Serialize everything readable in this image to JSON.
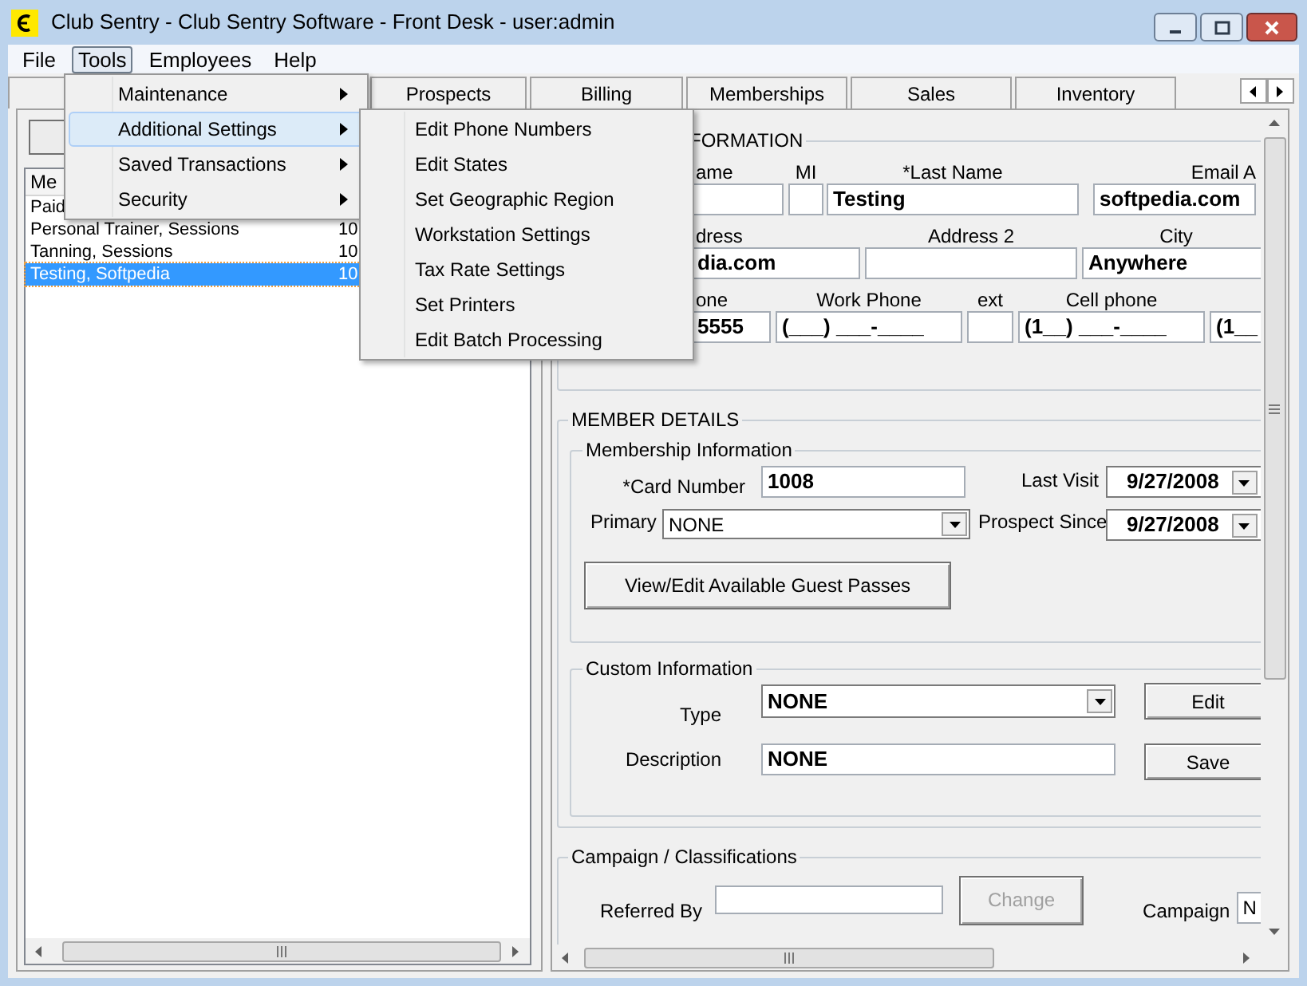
{
  "window": {
    "title": "Club Sentry - Club Sentry Software - Front Desk - user:admin"
  },
  "menu_bar": [
    {
      "label": "File",
      "selected": false
    },
    {
      "label": "Tools",
      "selected": true
    },
    {
      "label": "Employees",
      "selected": false
    },
    {
      "label": "Help",
      "selected": false
    }
  ],
  "tabs": [
    {
      "label": "Prospects"
    },
    {
      "label": "Billing"
    },
    {
      "label": "Memberships"
    },
    {
      "label": "Sales"
    },
    {
      "label": "Inventory"
    }
  ],
  "member_list": {
    "header": "Me",
    "rows": [
      {
        "name": "Paid",
        "selected": false
      },
      {
        "name": "Personal Trainer, Sessions",
        "number": "10",
        "selected": false
      },
      {
        "name": "Tanning, Sessions",
        "number": "10",
        "selected": false
      },
      {
        "name": "Testing, Softpedia",
        "number": "10",
        "selected": true
      }
    ]
  },
  "contact_information": {
    "title": "FORMATION",
    "rows": [
      {
        "fields": [
          {
            "label": "ame"
          },
          {
            "label": "MI"
          },
          {
            "label": "*Last Name",
            "value": "Testing"
          },
          {
            "label": "Email A",
            "value": "softpedia.com"
          }
        ]
      },
      {
        "fields": [
          {
            "label": "dress",
            "value": "dia.com"
          },
          {
            "label": "Address 2"
          },
          {
            "label": "City",
            "value": "Anywhere"
          }
        ]
      },
      {
        "fields": [
          {
            "label": "one",
            "value": "5555"
          },
          {
            "label": "Work Phone",
            "value": "(___) ___-____"
          },
          {
            "label": "ext"
          },
          {
            "label": "Cell phone",
            "value": "(1__) ___-____"
          },
          {
            "value": "(1__"
          }
        ]
      }
    ]
  },
  "member_details": {
    "title": "MEMBER DETAILS",
    "membership_information": {
      "title": "Membership Information",
      "card_number": {
        "label": "*Card Number",
        "value": "1008"
      },
      "last_visit": {
        "label": "Last Visit",
        "value": "9/27/2008"
      },
      "primary": {
        "label": "Primary",
        "value": "NONE"
      },
      "prospect_since": {
        "label": "Prospect Since",
        "value": "9/27/2008"
      },
      "guest_passes_button": "View/Edit Available Guest Passes"
    },
    "custom_information": {
      "title": "Custom Information",
      "type": {
        "label": "Type",
        "value": "NONE"
      },
      "description": {
        "label": "Description",
        "value": "NONE"
      },
      "edit_button": "Edit",
      "save_button": "Save"
    }
  },
  "campaign": {
    "title": "Campaign / Classifications",
    "referred_by": {
      "label": "Referred By"
    },
    "change_button": {
      "label": "Change",
      "disabled": true
    },
    "campaign": {
      "label": "Campaign",
      "value": "N"
    }
  },
  "tools_menu": [
    {
      "label": "Maintenance",
      "selected": false
    },
    {
      "label": "Additional Settings",
      "selected": true
    },
    {
      "label": "Saved Transactions",
      "selected": false
    },
    {
      "label": "Security",
      "selected": false
    }
  ],
  "submenu": [
    "Edit Phone Numbers",
    "Edit States",
    "Set Geographic Region",
    "Workstation Settings",
    "Tax Rate Settings",
    "Set Printers",
    "Edit Batch Processing"
  ]
}
